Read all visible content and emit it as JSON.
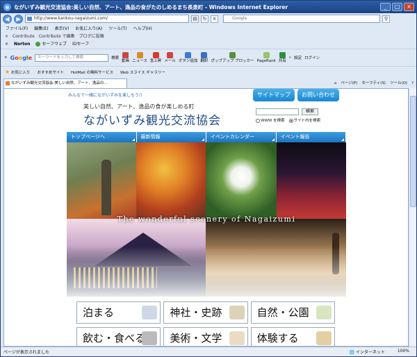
{
  "window": {
    "title": "ながいずみ観光交流協会:美しい自然、アート、逸品の食がたのしめるまち長泉町 - Windows Internet Explorer",
    "url": "http://www.kankou-nagaizumi.com/",
    "search_placeholder": "Google"
  },
  "menu": [
    "ファイル(F)",
    "編集(E)",
    "表示(V)",
    "お気に入り(A)",
    "ツール(T)",
    "ヘルプ(H)"
  ],
  "contribute": [
    "Contribute",
    "Contribute で編集",
    "ブログに投稿"
  ],
  "norton": {
    "brand": "Norton",
    "items": [
      "セーフウェブ",
      "IDセーフ"
    ]
  },
  "google_toolbar": {
    "search_placeholder": "キーワードを入力して検索",
    "search_button": "検索",
    "items": [
      "動画",
      "ニュース",
      "急上昇",
      "メール",
      "ボタン追加",
      "翻訳",
      "ポップアップ ブロッカー",
      "PageRank",
      "共有"
    ],
    "settings": "設定",
    "login": "ログイン"
  },
  "favorites": {
    "label": "お気に入り",
    "items": [
      "おすすめサイト",
      "HotMail の無料サービス",
      "Web スライス ギャラリー"
    ]
  },
  "tab": {
    "label": "ながいずみ観光交流協会:美しい自然、アート、逸品の...",
    "tools": [
      "ページ(P)",
      "セーフティ(S)",
      "ツール(O)"
    ]
  },
  "site": {
    "top_note": "みんなで一緒にながいずみを楽しもう!!",
    "top_buttons": [
      "サイトマップ",
      "お問い合わせ"
    ],
    "tagline": "美しい自然、アート、逸品の食が楽しめる町",
    "name": "ながいずみ観光交流協会",
    "search_button": "検索",
    "radio_options": [
      "WWW を検索",
      "サイト内を検索"
    ],
    "nav": [
      "トップページへ",
      "最新情報",
      "イベントカレンダー",
      "イベント報告"
    ],
    "hero_caption": "The wonderful scenery of Nagaizumi",
    "categories": [
      "泊まる",
      "神社・史跡",
      "自然・公園",
      "飲む・食べる",
      "美術・文学",
      "体験する"
    ]
  },
  "status": {
    "left": "ページが表示されました",
    "zone": "インターネット",
    "zoom": "100%"
  }
}
